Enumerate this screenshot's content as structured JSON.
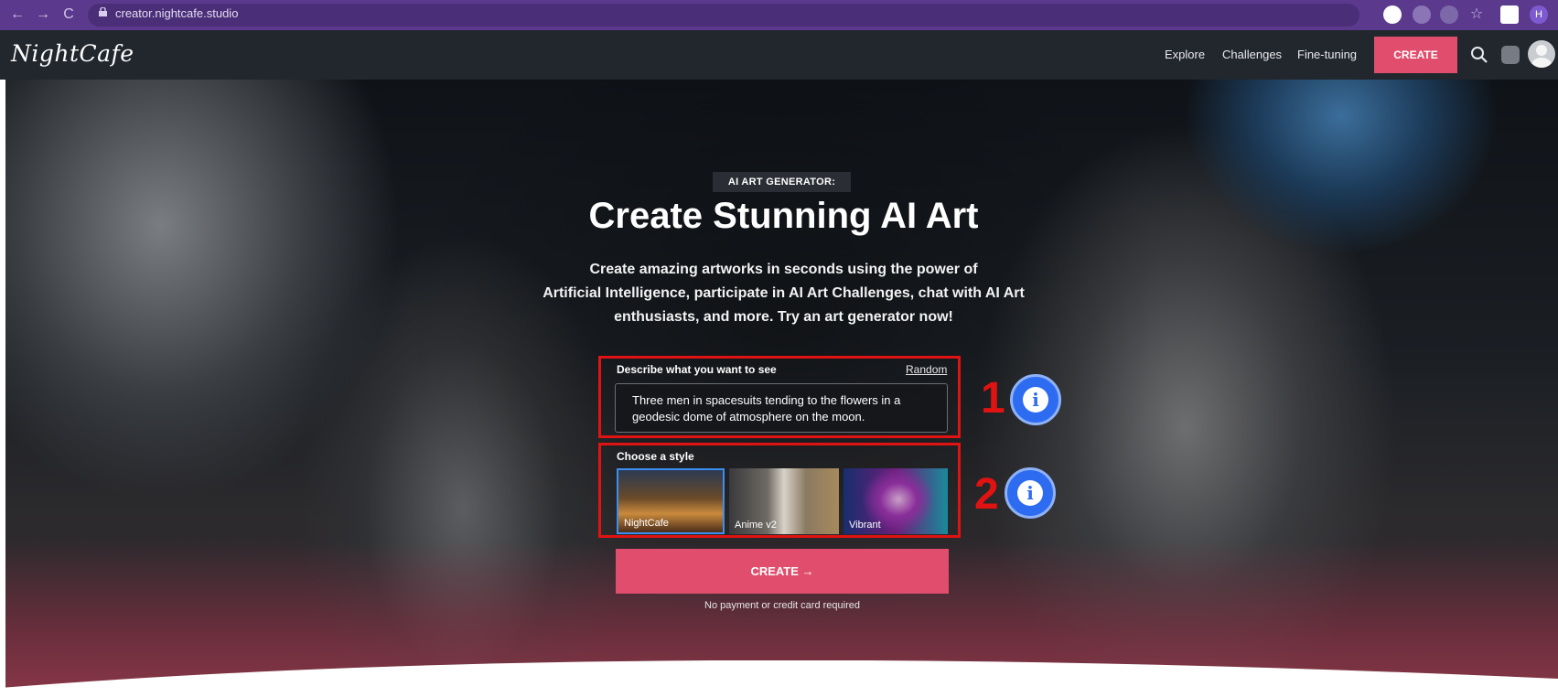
{
  "browser": {
    "url": "creator.nightcafe.studio",
    "back_glyph": "←",
    "forward_glyph": "→",
    "reload_glyph": "C",
    "profile_initial": "H"
  },
  "header": {
    "logo": "NightCafe",
    "nav": {
      "explore": "Explore",
      "challenges": "Challenges",
      "fine_tuning": "Fine-tuning"
    },
    "create_label": "CREATE"
  },
  "hero": {
    "eyebrow": "AI ART GENERATOR:",
    "title": "Create Stunning AI Art",
    "subtitle_lines": [
      "Create amazing artworks in seconds using the power of",
      "Artificial Intelligence, participate in AI Art Challenges, chat with AI Art",
      "enthusiasts, and more. Try an art generator now!"
    ]
  },
  "prompt": {
    "label": "Describe what you want to see",
    "random_label": "Random",
    "value": "Three men in spacesuits tending to the flowers in a geodesic dome of atmosphere on the moon."
  },
  "styles": {
    "label": "Choose a style",
    "items": [
      {
        "name": "NightCafe",
        "selected": true
      },
      {
        "name": "Anime v2",
        "selected": false
      },
      {
        "name": "Vibrant",
        "selected": false
      }
    ]
  },
  "cta": {
    "label": "CREATE →",
    "note": "No payment or credit card required"
  },
  "annotations": [
    {
      "number": "1",
      "icon": "info-icon"
    },
    {
      "number": "2",
      "icon": "info-icon"
    }
  ],
  "colors": {
    "accent": "#e14d6d",
    "browser": "#5b3a8e",
    "header": "#22262d",
    "annotation_red": "#e01212",
    "annotation_blue": "#2d6cf0"
  }
}
